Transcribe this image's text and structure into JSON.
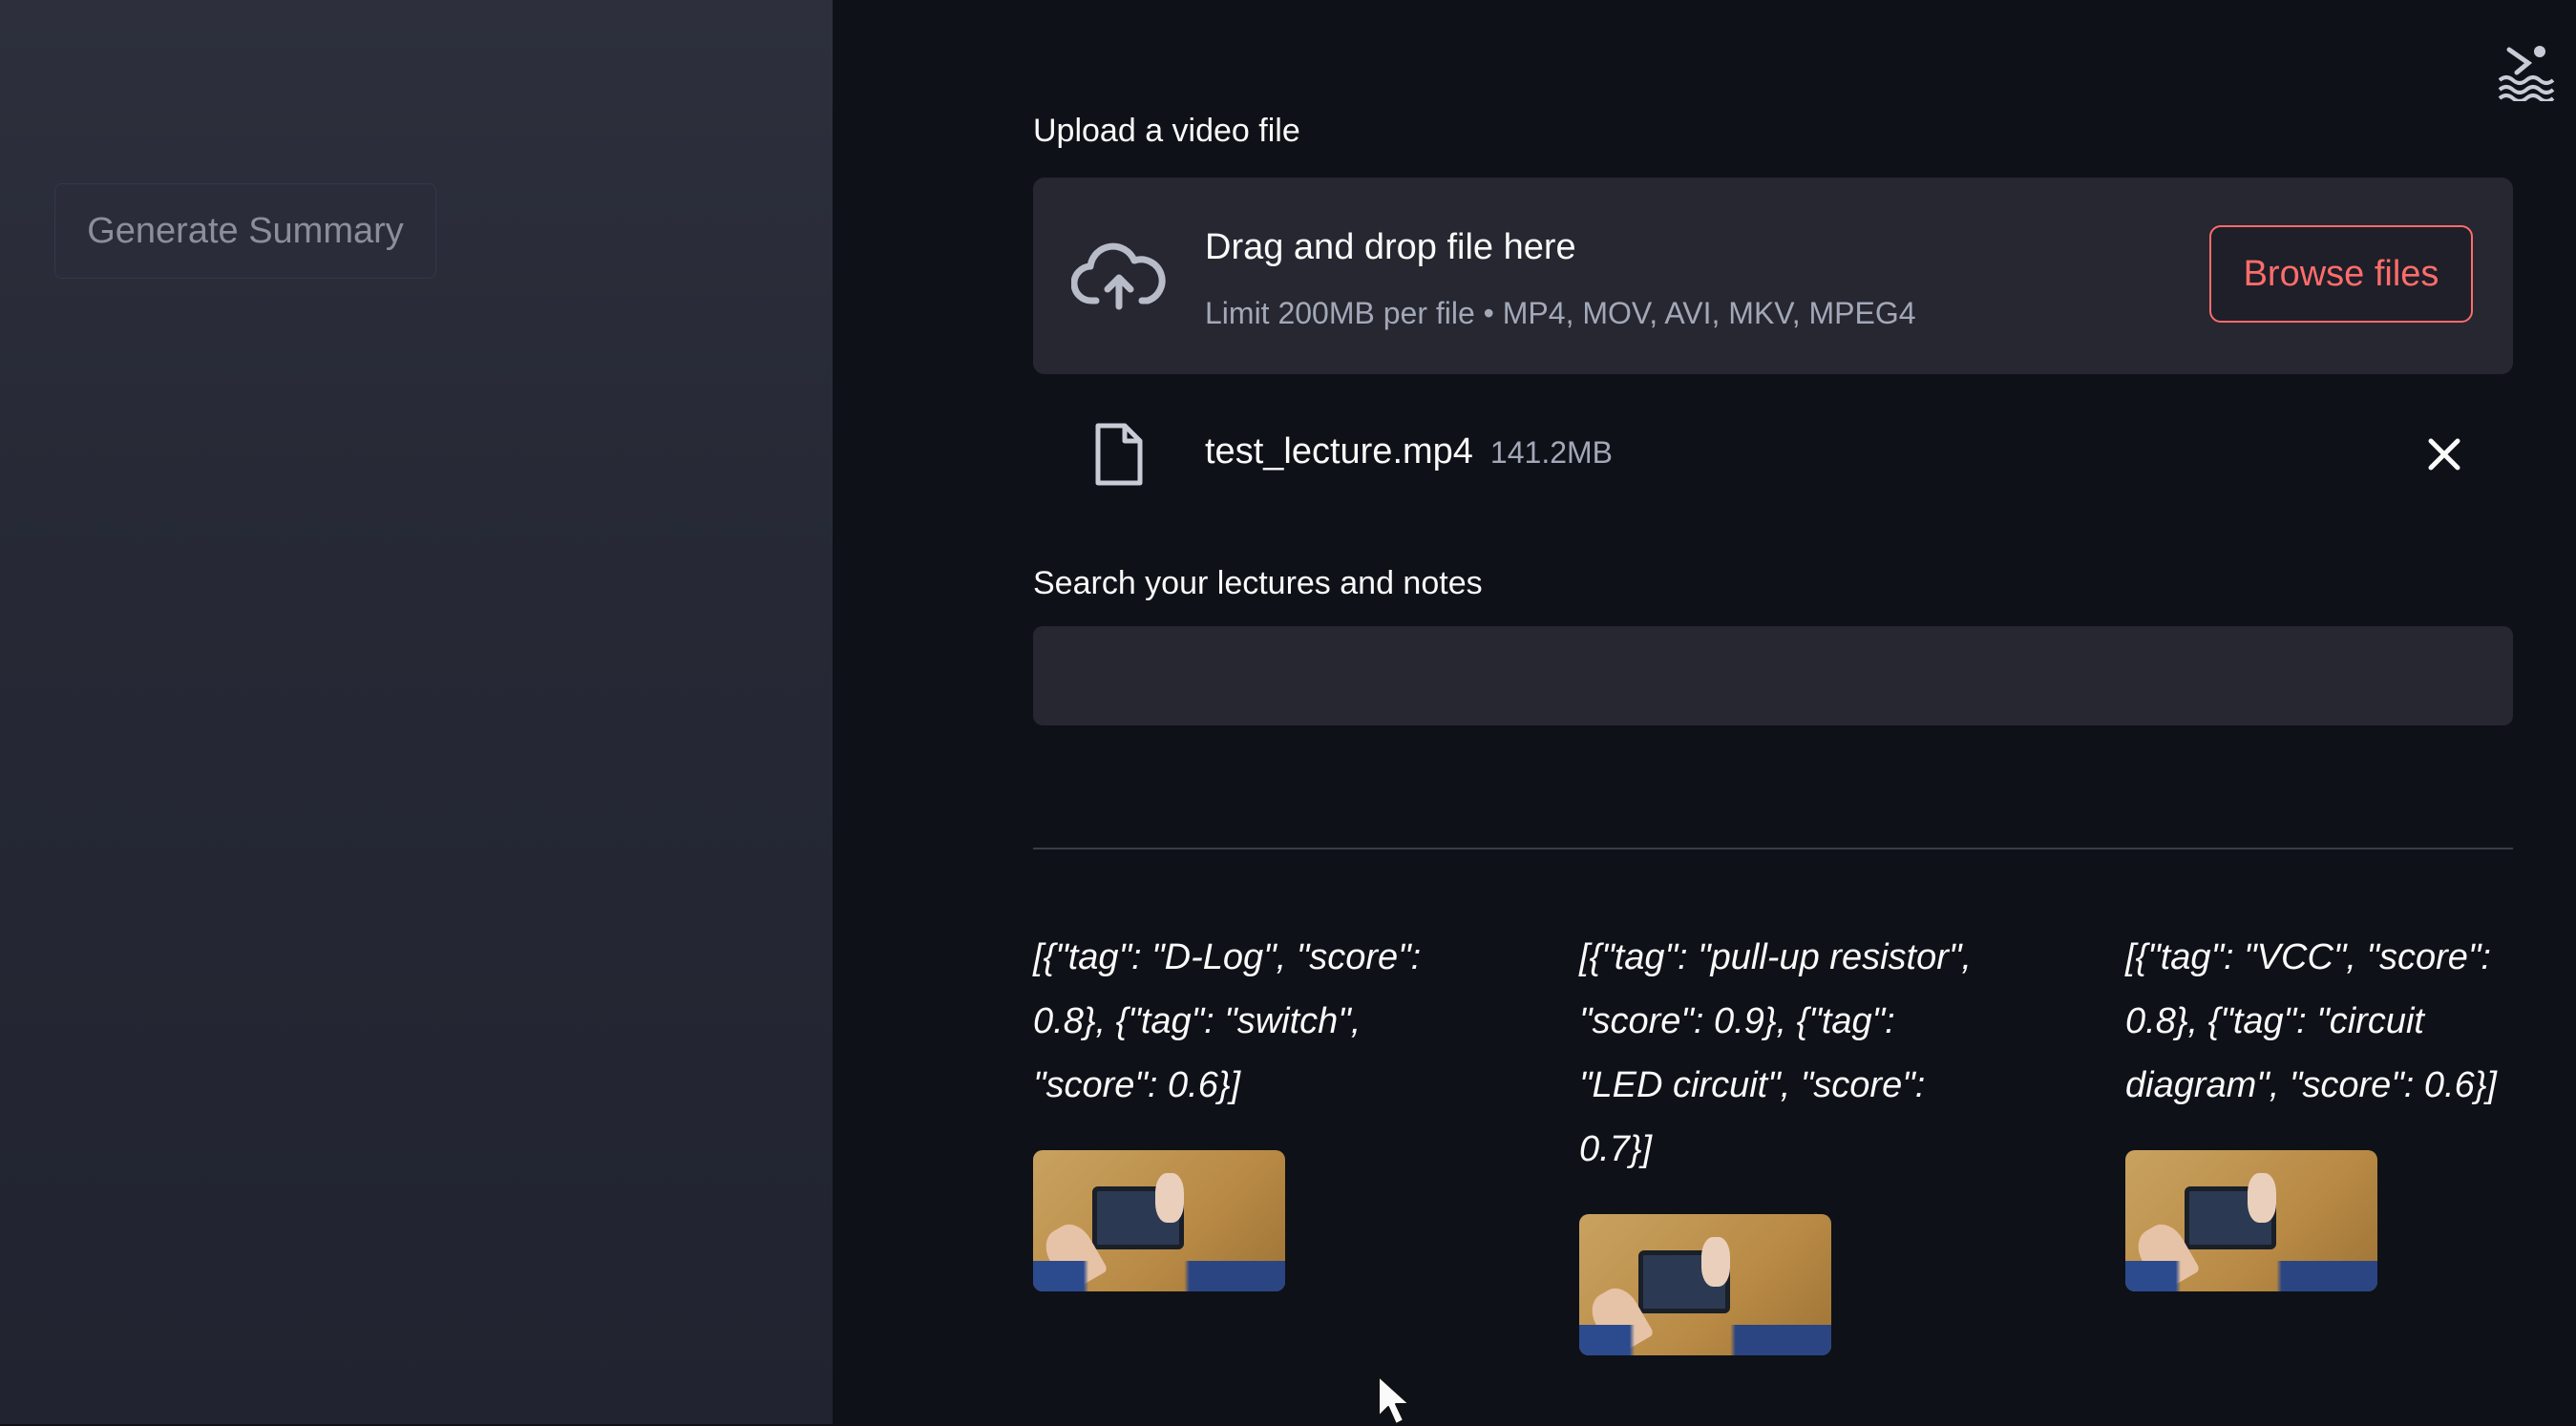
{
  "sidebar": {
    "generate_button_label": "Generate Summary"
  },
  "uploader": {
    "label": "Upload a video file",
    "drop_title": "Drag and drop file here",
    "drop_subtitle": "Limit 200MB per file • MP4, MOV, AVI, MKV, MPEG4",
    "browse_label": "Browse files"
  },
  "file": {
    "name": "test_lecture.mp4",
    "size": "141.2MB"
  },
  "search": {
    "label": "Search your lectures and notes",
    "value": "",
    "placeholder": ""
  },
  "results": [
    {
      "tags_text": "[{\"tag\": \"D-Log\", \"score\": 0.8}, {\"tag\": \"switch\", \"score\": 0.6}]"
    },
    {
      "tags_text": "[{\"tag\": \"pull-up resistor\", \"score\": 0.9}, {\"tag\": \"LED circuit\", \"score\": 0.7}]"
    },
    {
      "tags_text": "[{\"tag\": \"VCC\", \"score\": 0.8}, {\"tag\": \"circuit diagram\", \"score\": 0.6}]"
    }
  ],
  "colors": {
    "accent": "#ff6c6c",
    "background": "#0e1117",
    "sidebar": "#262935",
    "widget": "#262730"
  },
  "icons": {
    "deploy": "swimmer-icon",
    "upload": "cloud-upload-icon",
    "file": "file-icon",
    "remove": "close-icon"
  }
}
